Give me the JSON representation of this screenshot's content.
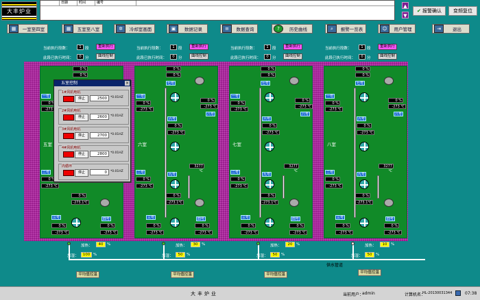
{
  "logo": {
    "name": "大丰炉业"
  },
  "alarm": {
    "col_date": "日期",
    "col_time": "时间",
    "col_code": "编号"
  },
  "top_buttons": {
    "confirm": "报警确认",
    "reset": "变频复位"
  },
  "nav": [
    {
      "label": "一室至四室",
      "icon": "grid-icon"
    },
    {
      "label": "五室至八室",
      "icon": "grid-icon"
    },
    {
      "label": "冷却室画面",
      "icon": "gear-icon"
    },
    {
      "label": "数据记录",
      "icon": "monitor-icon"
    },
    {
      "label": "数据查询",
      "icon": "document-icon"
    },
    {
      "label": "历史曲线",
      "icon": "question-icon"
    },
    {
      "label": "报警一览表",
      "icon": "search-icon"
    },
    {
      "label": "用户管理",
      "icon": "user-icon"
    },
    {
      "label": "退出",
      "icon": "exit-icon"
    }
  ],
  "controls": {
    "step_label": "当前执行段数：",
    "step_value": "1",
    "step_unit": "段",
    "time_label": "此段已执行时间：",
    "time_unit": "分",
    "reset_btn": "重新执行",
    "curve_btn": "曲线控制"
  },
  "rooms": [
    {
      "label": "五室",
      "heat": "40",
      "humid": "100"
    },
    {
      "label": "六室",
      "heat": "30",
      "humid": "50"
    },
    {
      "label": "七室",
      "heat": "20",
      "humid": "50"
    },
    {
      "label": "八室",
      "heat": "10",
      "humid": "50"
    }
  ],
  "readings": {
    "pct": "0 %",
    "temp": "-273 ℃",
    "pipe_temp": "3277 ℃",
    "pipe_temp2": "-273.1℃"
  },
  "tags": {
    "n1": "一号",
    "n2": "二号",
    "n3": "三号",
    "n4": "四号",
    "n6": "六号",
    "n7": "七号",
    "n8": "八号",
    "n9": "九号"
  },
  "labels": {
    "heat": "加热：",
    "humid": "加湿：",
    "pct": "%",
    "water_pipe": "供水管道",
    "balance": "平均值控温"
  },
  "dialog": {
    "title": "五室控制",
    "motors": [
      {
        "name": "1#风机电机",
        "value": "2500"
      },
      {
        "name": "2#风机电机",
        "value": "2600"
      },
      {
        "name": "3#风机电机",
        "value": "2700"
      },
      {
        "name": "4#风机电机",
        "value": "2800"
      },
      {
        "name": "内循环",
        "value": "0"
      }
    ],
    "stop": "停止",
    "unit": "*0.01HZ"
  },
  "status": {
    "title": "大丰炉业",
    "user_label": "当前用户：",
    "user": "admin",
    "pc_label": "计算机名：",
    "pc": "HL-20130031344",
    "clock": "07:38"
  }
}
